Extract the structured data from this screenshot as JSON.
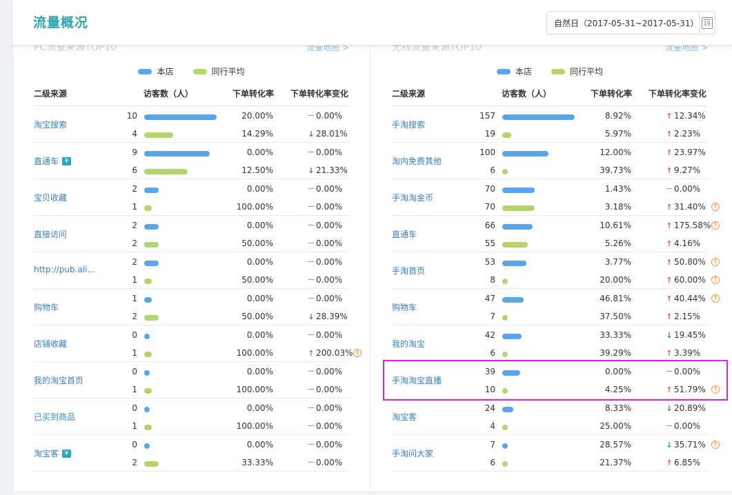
{
  "header": {
    "title": "流量概况",
    "date_range": "自然日（2017-05-31~2017-05-31）",
    "calendar_day": "15"
  },
  "legend": {
    "own": "本店",
    "avg": "同行平均"
  },
  "colors": {
    "own_bar": "#5aa4ea",
    "avg_bar": "#b4d56b",
    "up": "#e85a50",
    "down": "#2b9b3c",
    "highlight": "#e020e0"
  },
  "columns": {
    "source": "二级来源",
    "visitors": "访客数（人）",
    "rate": "下单转化率",
    "change": "下单转化率变化"
  },
  "left_panel": {
    "ghost_title": "PC流量来源TOP10",
    "ghost_link": "流量地图 >",
    "max_visitors": 10,
    "rows": [
      {
        "name": "淘宝搜索",
        "badge": "",
        "own": {
          "visitors": "10",
          "rate": "20.00%",
          "change": "0.00%",
          "dir": "flat",
          "warn": false
        },
        "avg": {
          "visitors": "4",
          "rate": "14.29%",
          "change": "28.01%",
          "dir": "down",
          "warn": false
        }
      },
      {
        "name": "直通车",
        "badge": "¥",
        "own": {
          "visitors": "9",
          "rate": "0.00%",
          "change": "0.00%",
          "dir": "flat",
          "warn": false
        },
        "avg": {
          "visitors": "6",
          "rate": "12.50%",
          "change": "21.33%",
          "dir": "down",
          "warn": false
        }
      },
      {
        "name": "宝贝收藏",
        "badge": "",
        "own": {
          "visitors": "2",
          "rate": "0.00%",
          "change": "0.00%",
          "dir": "flat",
          "warn": false
        },
        "avg": {
          "visitors": "1",
          "rate": "100.00%",
          "change": "0.00%",
          "dir": "flat",
          "warn": false
        }
      },
      {
        "name": "直接访问",
        "badge": "",
        "own": {
          "visitors": "2",
          "rate": "0.00%",
          "change": "0.00%",
          "dir": "flat",
          "warn": false
        },
        "avg": {
          "visitors": "2",
          "rate": "50.00%",
          "change": "0.00%",
          "dir": "flat",
          "warn": false
        }
      },
      {
        "name": "http://pub.ali...",
        "badge": "",
        "own": {
          "visitors": "2",
          "rate": "0.00%",
          "change": "0.00%",
          "dir": "flat",
          "warn": false
        },
        "avg": {
          "visitors": "1",
          "rate": "50.00%",
          "change": "0.00%",
          "dir": "flat",
          "warn": false
        }
      },
      {
        "name": "购物车",
        "badge": "",
        "own": {
          "visitors": "1",
          "rate": "0.00%",
          "change": "0.00%",
          "dir": "flat",
          "warn": false
        },
        "avg": {
          "visitors": "2",
          "rate": "50.00%",
          "change": "28.39%",
          "dir": "down",
          "warn": false
        }
      },
      {
        "name": "店铺收藏",
        "badge": "",
        "own": {
          "visitors": "0",
          "rate": "0.00%",
          "change": "0.00%",
          "dir": "flat",
          "warn": false
        },
        "avg": {
          "visitors": "1",
          "rate": "100.00%",
          "change": "200.03%",
          "dir": "up",
          "warn": true
        }
      },
      {
        "name": "我的淘宝首页",
        "badge": "",
        "own": {
          "visitors": "0",
          "rate": "0.00%",
          "change": "0.00%",
          "dir": "flat",
          "warn": false
        },
        "avg": {
          "visitors": "1",
          "rate": "100.00%",
          "change": "0.00%",
          "dir": "flat",
          "warn": false
        }
      },
      {
        "name": "已买到商品",
        "badge": "",
        "own": {
          "visitors": "0",
          "rate": "0.00%",
          "change": "0.00%",
          "dir": "flat",
          "warn": false
        },
        "avg": {
          "visitors": "1",
          "rate": "100.00%",
          "change": "0.00%",
          "dir": "flat",
          "warn": false
        }
      },
      {
        "name": "淘宝客",
        "badge": "¥",
        "own": {
          "visitors": "0",
          "rate": "0.00%",
          "change": "0.00%",
          "dir": "flat",
          "warn": false
        },
        "avg": {
          "visitors": "2",
          "rate": "33.33%",
          "change": "0.00%",
          "dir": "flat",
          "warn": false
        }
      }
    ]
  },
  "right_panel": {
    "ghost_title": "无线流量来源TOP10",
    "ghost_link": "流量地图 >",
    "max_visitors": 157,
    "rows": [
      {
        "name": "手淘搜索",
        "badge": "",
        "own": {
          "visitors": "157",
          "rate": "8.92%",
          "change": "12.34%",
          "dir": "up",
          "warn": false
        },
        "avg": {
          "visitors": "19",
          "rate": "5.97%",
          "change": "2.23%",
          "dir": "up",
          "warn": false
        }
      },
      {
        "name": "淘内免费其他",
        "badge": "",
        "own": {
          "visitors": "100",
          "rate": "12.00%",
          "change": "23.97%",
          "dir": "up",
          "warn": false
        },
        "avg": {
          "visitors": "6",
          "rate": "39.73%",
          "change": "9.27%",
          "dir": "up",
          "warn": false
        }
      },
      {
        "name": "手淘淘金币",
        "badge": "",
        "own": {
          "visitors": "70",
          "rate": "1.43%",
          "change": "0.00%",
          "dir": "flat",
          "warn": false
        },
        "avg": {
          "visitors": "70",
          "rate": "3.18%",
          "change": "31.40%",
          "dir": "up",
          "warn": true
        }
      },
      {
        "name": "直通车",
        "badge": "",
        "own": {
          "visitors": "66",
          "rate": "10.61%",
          "change": "175.58%",
          "dir": "up",
          "warn": true
        },
        "avg": {
          "visitors": "55",
          "rate": "5.26%",
          "change": "4.16%",
          "dir": "up",
          "warn": false
        }
      },
      {
        "name": "手淘首页",
        "badge": "",
        "own": {
          "visitors": "53",
          "rate": "3.77%",
          "change": "50.80%",
          "dir": "up",
          "warn": true
        },
        "avg": {
          "visitors": "8",
          "rate": "20.00%",
          "change": "60.00%",
          "dir": "up",
          "warn": true
        }
      },
      {
        "name": "购物车",
        "badge": "",
        "own": {
          "visitors": "47",
          "rate": "46.81%",
          "change": "40.44%",
          "dir": "up",
          "warn": true
        },
        "avg": {
          "visitors": "7",
          "rate": "37.50%",
          "change": "2.15%",
          "dir": "up",
          "warn": false
        }
      },
      {
        "name": "我的淘宝",
        "badge": "",
        "own": {
          "visitors": "42",
          "rate": "33.33%",
          "change": "19.45%",
          "dir": "down",
          "warn": false
        },
        "avg": {
          "visitors": "6",
          "rate": "39.29%",
          "change": "3.39%",
          "dir": "up",
          "warn": false
        }
      },
      {
        "name": "手淘淘宝直播",
        "badge": "",
        "own": {
          "visitors": "39",
          "rate": "0.00%",
          "change": "0.00%",
          "dir": "flat",
          "warn": false
        },
        "avg": {
          "visitors": "10",
          "rate": "4.25%",
          "change": "51.79%",
          "dir": "up",
          "warn": true
        }
      },
      {
        "name": "淘宝客",
        "badge": "",
        "own": {
          "visitors": "24",
          "rate": "8.33%",
          "change": "20.89%",
          "dir": "down",
          "warn": false
        },
        "avg": {
          "visitors": "4",
          "rate": "25.00%",
          "change": "0.00%",
          "dir": "flat",
          "warn": false
        }
      },
      {
        "name": "手淘问大家",
        "badge": "",
        "own": {
          "visitors": "7",
          "rate": "28.57%",
          "change": "35.71%",
          "dir": "down",
          "warn": true
        },
        "avg": {
          "visitors": "6",
          "rate": "21.37%",
          "change": "6.85%",
          "dir": "up",
          "warn": false
        }
      }
    ]
  }
}
